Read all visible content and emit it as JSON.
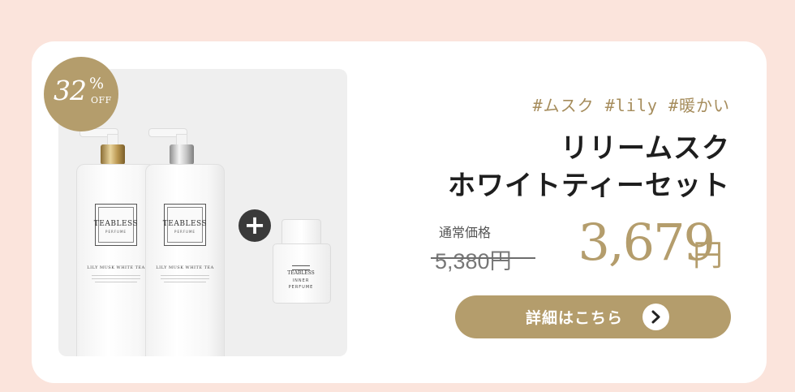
{
  "badge": {
    "number": "32",
    "percent": "%",
    "off": "OFF"
  },
  "product_panel": {
    "bottles": [
      {
        "brand": "TEABLESS",
        "sub": "PERFUME",
        "name": "LILY MUSK WHITE TEA"
      },
      {
        "brand": "TEABLESS",
        "sub": "PERFUME",
        "name": "LILY MUSK WHITE TEA"
      }
    ],
    "plus": "+",
    "perfume": {
      "brand": "TEABLESS",
      "line1": "INNER",
      "line2": "PERFUME"
    }
  },
  "tags": "#ムスク #lily #暖かい",
  "title": {
    "line1": "リリームスク",
    "line2": "ホワイトティーセット"
  },
  "pricing": {
    "regular_label": "通常価格",
    "regular_price": "5,380円",
    "sale_price": "3,679",
    "sale_unit": "円"
  },
  "button": {
    "label": "詳細はこちら",
    "icon": "chevron-right-icon"
  },
  "colors": {
    "background": "#fbe4dc",
    "accent": "#b49d6c",
    "card": "#ffffff",
    "panel": "#efefef"
  }
}
